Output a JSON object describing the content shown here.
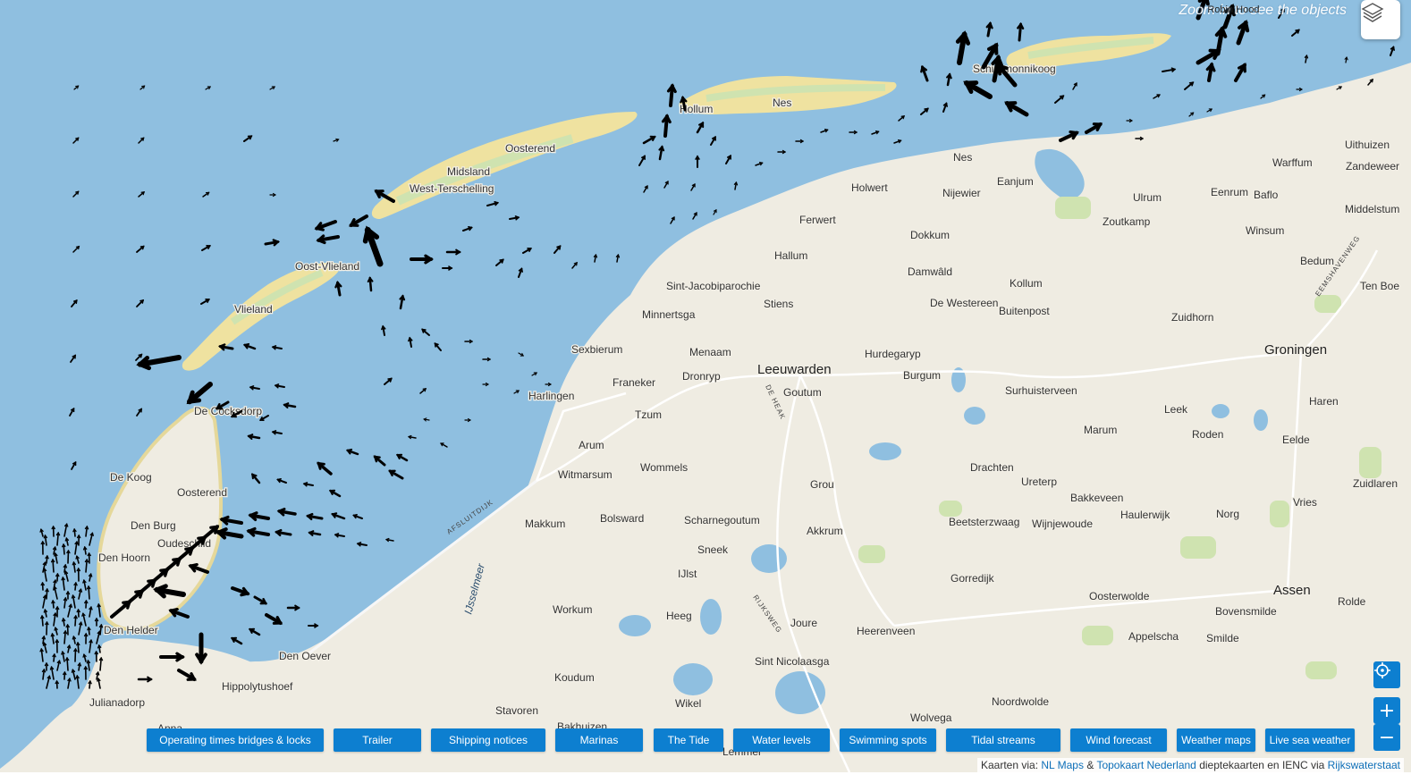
{
  "map": {
    "zoom_hint": "Zoom in to see the objects",
    "zoom_hint_overlay": "Robin Hood"
  },
  "places": {
    "west_terschelling": "West-Terschelling",
    "midsland": "Midsland",
    "oosterend_t": "Oosterend",
    "hollum": "Hollum",
    "nes_a": "Nes",
    "schiermonnikoog": "Schiermonnikoog",
    "oost_vlieland": "Oost-Vlieland",
    "vlieland": "Vlieland",
    "de_cocksdorp": "De Cocksdorp",
    "de_koog": "De Koog",
    "oosterend_tx": "Oosterend",
    "den_burg": "Den Burg",
    "oudeschild": "Oudeschild",
    "den_hoorn": "Den Hoorn",
    "den_helder": "Den Helder",
    "den_oever": "Den Oever",
    "hippolytushoef": "Hippolytushoef",
    "julianadorp": "Julianadorp",
    "anna": "Anna",
    "nes_f": "Nes",
    "holwert": "Holwert",
    "nijewier": "Nijewier",
    "ferwert": "Ferwert",
    "dokkum": "Dokkum",
    "hallum": "Hallum",
    "damwald": "Damwâld",
    "kollum": "Kollum",
    "sint_jacobiparochie": "Sint-Jacobiparochie",
    "minnertsga": "Minnertsga",
    "stiens": "Stiens",
    "de_westereen": "De Westereen",
    "buitenpost": "Buitenpost",
    "sexbierum": "Sexbierum",
    "menaam": "Menaam",
    "leeuwarden": "Leeuwarden",
    "hurdegaryp": "Hurdegaryp",
    "burgum": "Burgum",
    "harlingen": "Harlingen",
    "franeker": "Franeker",
    "dronryp": "Dronryp",
    "goutum": "Goutum",
    "surhuisterveen": "Surhuisterveen",
    "tzum": "Tzum",
    "arum": "Arum",
    "witmarsum": "Witmarsum",
    "wommels": "Wommels",
    "grou": "Grou",
    "drachten": "Drachten",
    "ureterp": "Ureterp",
    "makkum": "Makkum",
    "bolsward": "Bolsward",
    "scharnegoutum": "Scharnegoutum",
    "akkrum": "Akkrum",
    "beetsterzwaag": "Beetsterzwaag",
    "wijnjewoude": "Wijnjewoude",
    "sneek": "Sneek",
    "ijlst": "IJlst",
    "workum": "Workum",
    "heeg": "Heeg",
    "joure": "Joure",
    "heerenveen": "Heerenveen",
    "gorredijk": "Gorredijk",
    "oosterwolde": "Oosterwolde",
    "sint_nicolaasga": "Sint Nicolaasga",
    "koudum": "Koudum",
    "wikel": "Wikel",
    "noordwolde": "Noordwolde",
    "stavoren": "Stavoren",
    "bakhuizen": "Bakhuizen",
    "wolvega": "Wolvega",
    "lemmer": "Lemmer",
    "enjum": "Eanjum",
    "ulrum": "Ulrum",
    "zoutkamp": "Zoutkamp",
    "eenrum": "Eenrum",
    "baflo": "Baflo",
    "warffum": "Warffum",
    "uithuizen": "Uithuizen",
    "zandeweer": "Zandeweer",
    "middelstum": "Middelstum",
    "winsum": "Winsum",
    "bedum": "Bedum",
    "ten_boer": "Ten Boe",
    "zuidhorn": "Zuidhorn",
    "groningen": "Groningen",
    "haren": "Haren",
    "leek": "Leek",
    "marum": "Marum",
    "roden": "Roden",
    "eelde": "Eelde",
    "zuidlaren": "Zuidlaren",
    "bakkeveen": "Bakkeveen",
    "haulerwijk": "Haulerwijk",
    "norg": "Norg",
    "vries": "Vries",
    "assen": "Assen",
    "rolde": "Rolde",
    "bovensmilde": "Bovensmilde",
    "smilde": "Smilde",
    "appelscha": "Appelscha"
  },
  "water_labels": {
    "ijsselmeer": "IJsselmeer",
    "afsluitdijk": "AFSLUITDIJK",
    "de_heak": "DE HEAK",
    "rijksweg": "RIJKSWEG",
    "eemshavenweg": "EEMSHAVENWEG"
  },
  "buttons": [
    {
      "label": "Operating times bridges & locks"
    },
    {
      "label": "Trailer"
    },
    {
      "label": "Shipping notices"
    },
    {
      "label": "Marinas"
    },
    {
      "label": "The Tide"
    },
    {
      "label": "Water levels"
    },
    {
      "label": "Swimming spots"
    },
    {
      "label": "Tidal streams"
    },
    {
      "label": "Wind forecast"
    },
    {
      "label": "Weather maps"
    },
    {
      "label": "Live sea weather"
    }
  ],
  "controls": {
    "locate": "crosshair-icon",
    "zoom_in": "+",
    "zoom_out": "−"
  },
  "attribution": {
    "prefix": "Kaarten via:",
    "link1": "NL Maps",
    "amp": "&",
    "link2": "Topokaart Nederland",
    "middle": "dieptekaarten en IENC via",
    "link3": "Rijkswaterstaat"
  },
  "colors": {
    "sea": "#8fbfe0",
    "land": "#efece2",
    "dune": "#efe2a0",
    "green": "#cfe3b0",
    "button": "#0d7fd0"
  }
}
